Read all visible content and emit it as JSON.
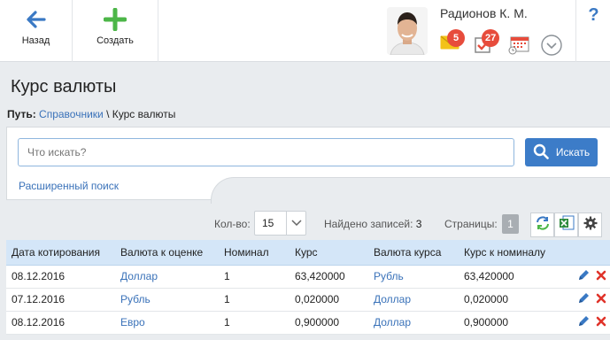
{
  "toolbar": {
    "back_label": "Назад",
    "create_label": "Создать",
    "user_name": "Радионов К. М.",
    "messages_count": "5",
    "tasks_count": "27",
    "help_label": "?"
  },
  "page": {
    "title": "Курс валюты",
    "breadcrumb_lead": "Путь:",
    "breadcrumb_link": "Справочники",
    "breadcrumb_sep": "\\",
    "breadcrumb_current": "Курс валюты"
  },
  "search": {
    "placeholder": "Что искать?",
    "button_label": "Искать",
    "advanced_label": "Расширенный поиск"
  },
  "paging": {
    "count_label": "Кол-во:",
    "count_value": "15",
    "found_label": "Найдено записей:",
    "found_value": "3",
    "pages_label": "Страницы:",
    "page_value": "1"
  },
  "table": {
    "columns": [
      "Дата котирования",
      "Валюта к оценке",
      "Номинал",
      "Курс",
      "Валюта курса",
      "Курс к номиналу"
    ],
    "rows": [
      [
        "08.12.2016",
        "Доллар",
        "1",
        "63,420000",
        "Рубль",
        "63,420000"
      ],
      [
        "07.12.2016",
        "Рубль",
        "1",
        "0,020000",
        "Доллар",
        "0,020000"
      ],
      [
        "08.12.2016",
        "Евро",
        "1",
        "0,900000",
        "Доллар",
        "0,900000"
      ]
    ]
  },
  "colors": {
    "accent_blue": "#3c7cc8",
    "create_green": "#4cb648",
    "badge_red": "#e74c3c",
    "header_row": "#d4e6f8"
  }
}
